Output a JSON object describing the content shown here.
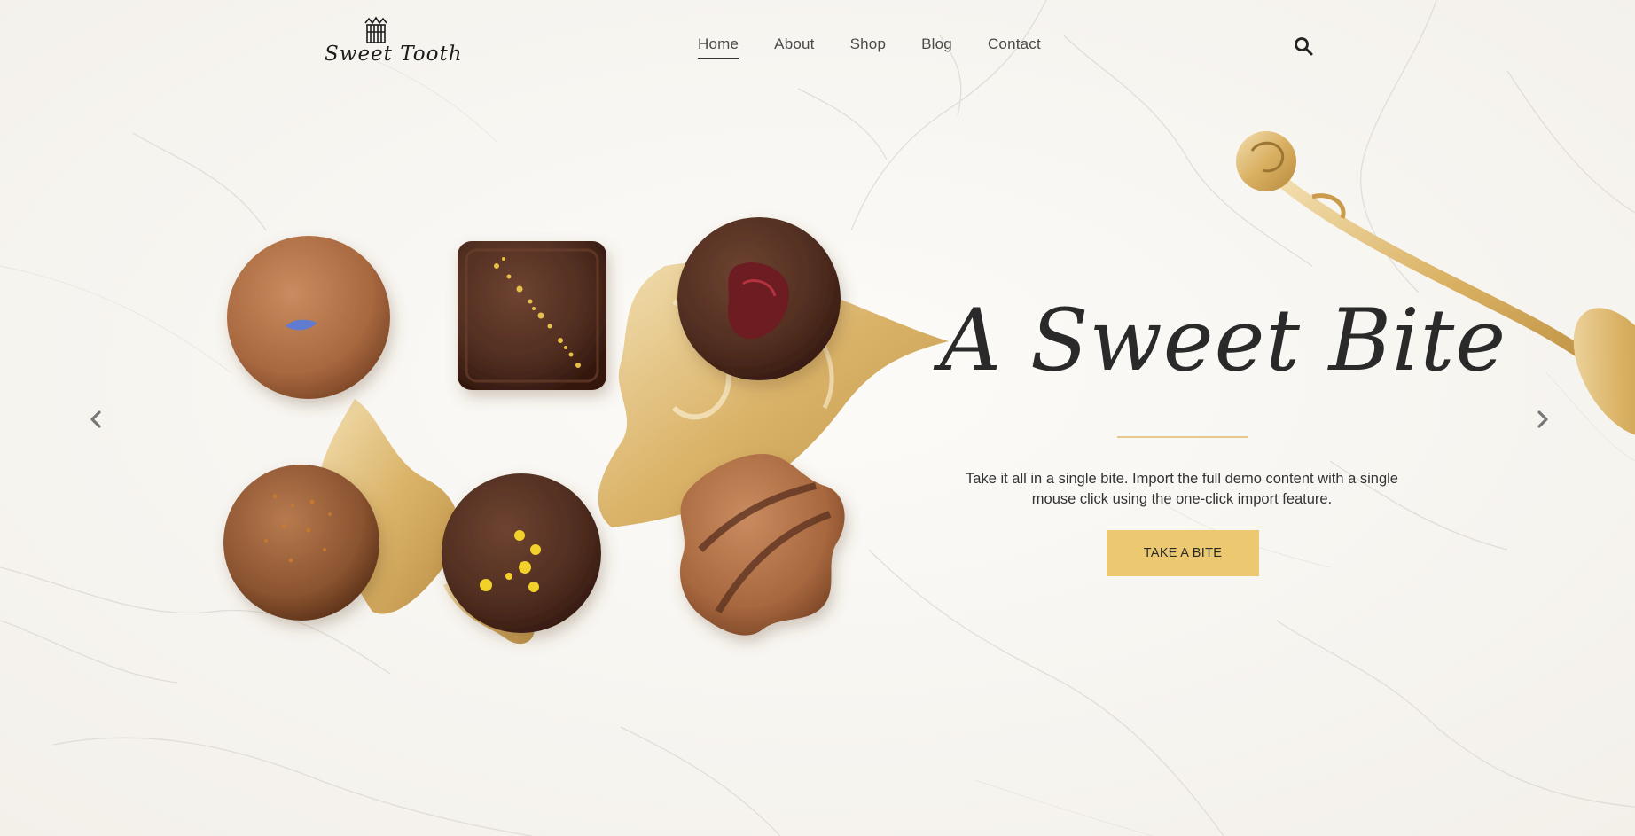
{
  "brand": {
    "name": "Sweet Tooth"
  },
  "nav": {
    "items": [
      {
        "label": "Home",
        "active": true
      },
      {
        "label": "About",
        "active": false
      },
      {
        "label": "Shop",
        "active": false
      },
      {
        "label": "Blog",
        "active": false
      },
      {
        "label": "Contact",
        "active": false
      }
    ]
  },
  "icons": {
    "search": "search-icon",
    "prev": "chevron-left-icon",
    "next": "chevron-right-icon",
    "crown": "crown-icon"
  },
  "hero": {
    "title": "A Sweet Bite",
    "description": "Take it all in a single bite. Import the full demo content with a single mouse click using the one-click import feature.",
    "cta_label": "TAKE A BITE"
  },
  "colors": {
    "accent": "#ecc970",
    "divider": "#e7c88f",
    "background": "#f9f7f3",
    "text": "#2b2b2b"
  }
}
